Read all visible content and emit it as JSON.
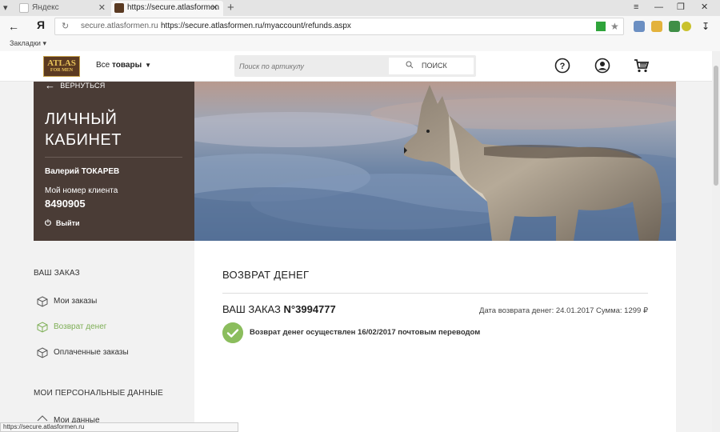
{
  "browser": {
    "tabs": [
      {
        "label": "Яндекс",
        "active": false
      },
      {
        "label": "https://secure.atlasformen",
        "active": true
      }
    ],
    "address_domain": "secure.atlasformen.ru",
    "address_url": "https://secure.atlasformen.ru/myaccount/refunds.aspx",
    "yandex_letter": "Я",
    "bookmarks_label": "Закладки ▾",
    "status_url": "https://secure.atlasformen.ru"
  },
  "header": {
    "logo_line1": "ATLAS",
    "logo_line2": "FOR MEN",
    "all_goods_prefix": "Все",
    "all_goods_bold": "товары",
    "search_placeholder": "Поиск по артикулу",
    "search_button": "ПОИСК"
  },
  "profile": {
    "back_label": "ВЕРНУТЬСЯ",
    "title_line1": "ЛИЧНЫЙ",
    "title_line2": "КАБИНЕТ",
    "user_name": "Валерий ТОКАРЕВ",
    "client_label": "Мой номер клиента",
    "client_number": "8490905",
    "logout_label": "Выйти"
  },
  "menu": {
    "order_section": "ВАШ ЗАКАЗ",
    "items": [
      {
        "label": "Мои заказы",
        "active": false
      },
      {
        "label": "Возврат денег",
        "active": true
      },
      {
        "label": "Оплаченные заказы",
        "active": false
      }
    ],
    "personal_section": "МОИ ПЕРСОНАЛЬНЫЕ ДАННЫЕ",
    "personal_items": [
      {
        "label": "Мои данные"
      }
    ]
  },
  "content": {
    "title": "ВОЗВРАТ ДЕНЕГ",
    "order_prefix": "ВАШ ЗАКАЗ",
    "order_number": "N°3994777",
    "order_meta": "Дата возврата денег: 24.01.2017 Сумма: 1299 ₽",
    "status_text": "Возврат денег осуществлен 16/02/2017 почтовым переводом"
  },
  "colors": {
    "accent_green": "#8bbd5d",
    "profile_panel": "#4a3c36",
    "brand_brown": "#5b3a21"
  }
}
